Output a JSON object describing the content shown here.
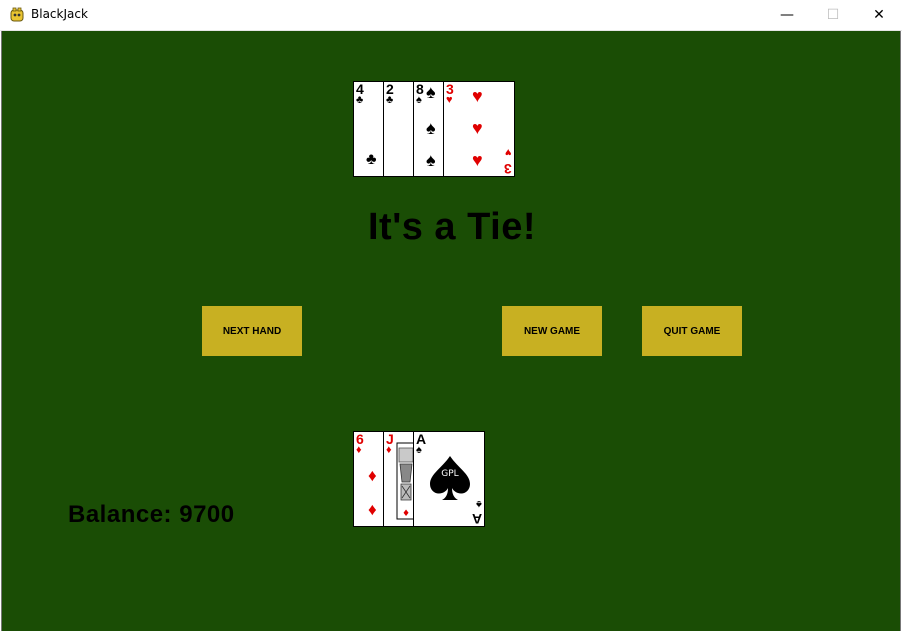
{
  "window": {
    "title": "BlackJack",
    "minimize_glyph": "—",
    "maximize_glyph": "☐",
    "close_glyph": "✕"
  },
  "dealer_hand": [
    {
      "rank": "4",
      "suit": "♣",
      "color": "black"
    },
    {
      "rank": "2",
      "suit": "♣",
      "color": "black"
    },
    {
      "rank": "8",
      "suit": "♠",
      "color": "black"
    },
    {
      "rank": "3",
      "suit": "♥",
      "color": "red"
    }
  ],
  "player_hand": [
    {
      "rank": "6",
      "suit": "♦",
      "color": "red"
    },
    {
      "rank": "J",
      "suit": "♦",
      "color": "red"
    },
    {
      "rank": "A",
      "suit": "♠",
      "color": "black",
      "center_text": "GPL"
    }
  ],
  "result_message": "It's a Tie!",
  "buttons": {
    "next_hand": "NEXT HAND",
    "new_game": "NEW GAME",
    "quit_game": "QUIT GAME"
  },
  "balance": {
    "label": "Balance:",
    "value": "9700"
  },
  "colors": {
    "table": "#1a4d05",
    "button": "#c8b022",
    "red_suit": "#e00000"
  }
}
